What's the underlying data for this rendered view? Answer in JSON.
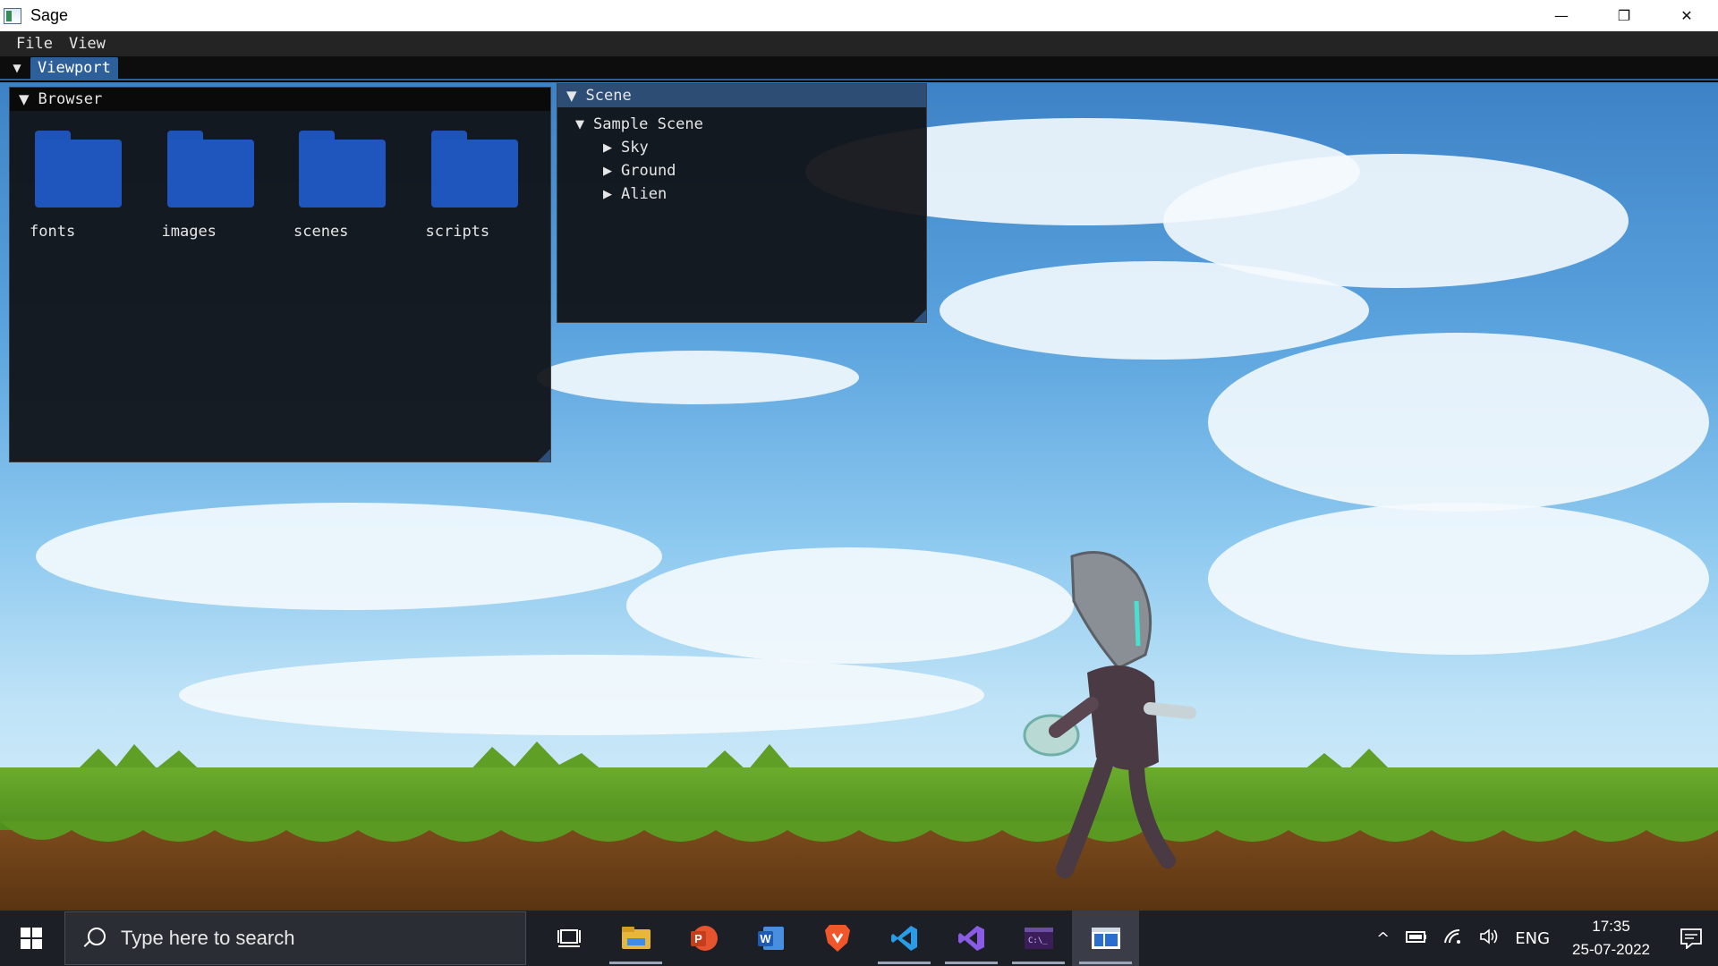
{
  "window": {
    "title": "Sage",
    "controls": {
      "minimize": "—",
      "restore": "❐",
      "close": "✕"
    }
  },
  "menubar": {
    "items": [
      "File",
      "View"
    ]
  },
  "dock": {
    "arrow": "▼",
    "tab_label": "Viewport"
  },
  "browser": {
    "title": "Browser",
    "caret": "▼",
    "folders": [
      "fonts",
      "images",
      "scenes",
      "scripts"
    ],
    "folder_color": "#1f56bd"
  },
  "scene": {
    "title": "Scene",
    "caret": "▼",
    "root": {
      "label": "Sample Scene",
      "twisty": "▼"
    },
    "children": [
      {
        "label": "Sky",
        "twisty": "▶"
      },
      {
        "label": "Ground",
        "twisty": "▶"
      },
      {
        "label": "Alien",
        "twisty": "▶"
      }
    ]
  },
  "taskbar": {
    "search_placeholder": "Type here to search",
    "apps": [
      "task-view-icon",
      "file-explorer-icon",
      "powerpoint-icon",
      "word-icon",
      "brave-icon",
      "vscode-icon",
      "visual-studio-icon",
      "terminal-icon",
      "sage-app-icon"
    ],
    "tray": {
      "chevron": "^",
      "language": "ENG"
    },
    "clock": {
      "time": "17:35",
      "date": "25-07-2022"
    }
  },
  "colors": {
    "accent": "#2d5f9a",
    "panel_bg": "#101216",
    "sky": "#5aa3de",
    "grass": "#6bab2c"
  }
}
